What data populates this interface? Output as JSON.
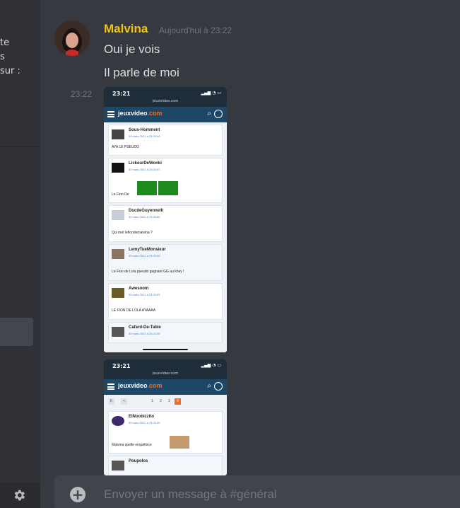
{
  "sidebar": {
    "text_lines": [
      "te",
      "s",
      "sur :"
    ]
  },
  "message": {
    "username": "Malvina",
    "timestamp": "Aujourd'hui à 23:22",
    "lines": [
      "Oui je vois",
      "Il parle de moi"
    ],
    "hover_time": "23:22",
    "colors": {
      "username": "#f1c40f",
      "background": "#36393f"
    }
  },
  "screenshot1": {
    "status_time": "23:21",
    "url": "jeuxvideo.com",
    "logo_main": "jeuxvideo",
    "logo_suffix": ".com",
    "posts": [
      {
        "author": "Sous-Homment",
        "date": "30 mars 2021 à 23:20:40",
        "text": "AYA LE PSEUDO"
      },
      {
        "author": "LickeurDeWonki",
        "date": "30 mars 2021 à 23:20:47",
        "text": "Le Fion De"
      },
      {
        "author": "DucdeGuyennelll",
        "date": "30 mars 2021 à 23:20:55",
        "text": "Qui met lefiondemalvina ?"
      },
      {
        "author": "LemyTueMonsieur",
        "date": "30 mars 2021 à 23:20:55",
        "text": "Le Fion de Lola pseudo gagnant GG au khey !"
      },
      {
        "author": "Awesoom",
        "date": "30 mars 2021 à 23:20:53",
        "text": "LE FION DE LOLA AYAAAA"
      },
      {
        "author": "Cafard-De-Table",
        "date": "30 mars 2021 à 23:21:05",
        "text": ""
      }
    ]
  },
  "screenshot2": {
    "status_time": "23:21",
    "url": "jeuxvideo.com",
    "logo_main": "jeuxvideo",
    "logo_suffix": ".com",
    "pager": [
      "K",
      "<",
      "1",
      "2",
      "3",
      "4"
    ],
    "posts": [
      {
        "author": "ElNoobizzito",
        "date": "30 mars 2021 à 23:20:39",
        "text": "Malvina quelle enquêtrice"
      },
      {
        "author": "Poupolos",
        "date": "",
        "text": ""
      }
    ]
  },
  "composer": {
    "placeholder": "Envoyer un message à #général"
  }
}
